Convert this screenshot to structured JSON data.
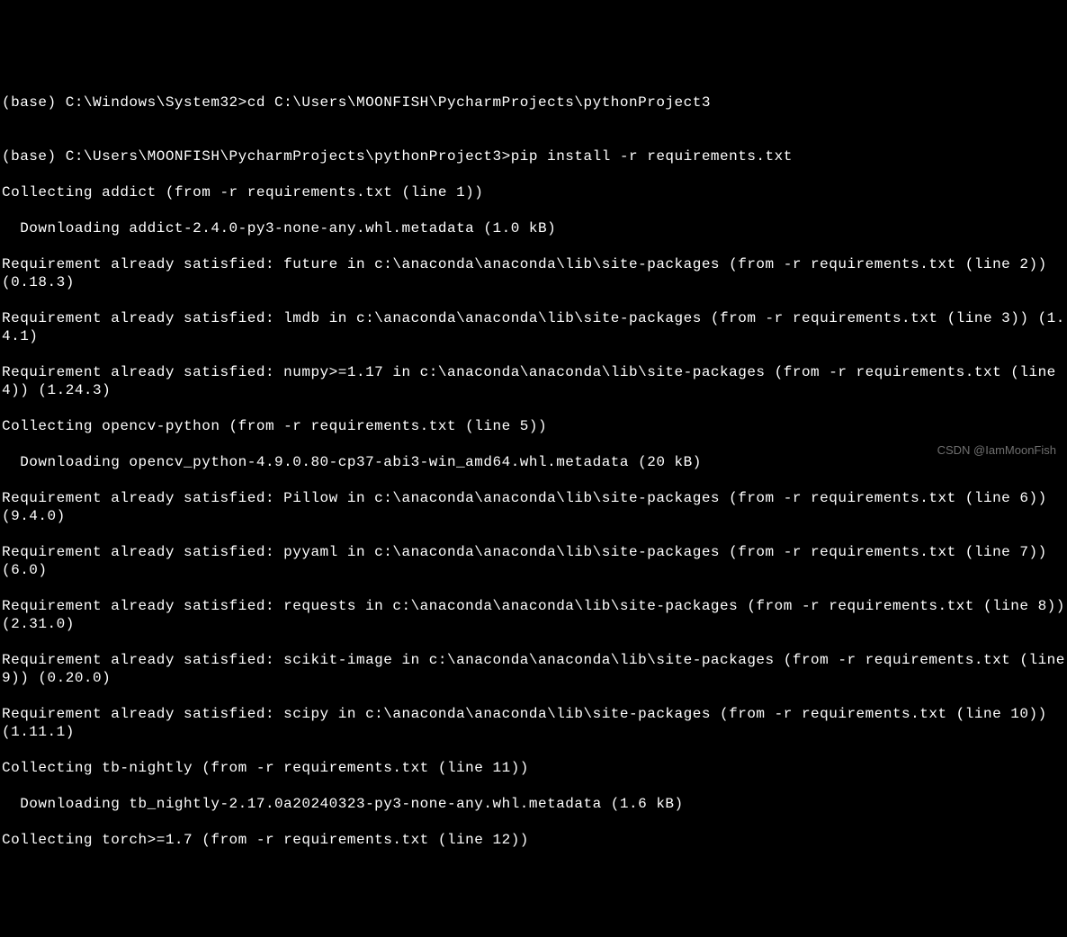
{
  "terminal": {
    "lines": [
      "(base) C:\\Windows\\System32>cd C:\\Users\\MOONFISH\\PycharmProjects\\pythonProject3",
      "",
      "(base) C:\\Users\\MOONFISH\\PycharmProjects\\pythonProject3>pip install -r requirements.txt",
      "Collecting addict (from -r requirements.txt (line 1))",
      "  Downloading addict-2.4.0-py3-none-any.whl.metadata (1.0 kB)",
      "Requirement already satisfied: future in c:\\anaconda\\anaconda\\lib\\site-packages (from -r requirements.txt (line 2)) (0.18.3)",
      "Requirement already satisfied: lmdb in c:\\anaconda\\anaconda\\lib\\site-packages (from -r requirements.txt (line 3)) (1.4.1)",
      "Requirement already satisfied: numpy>=1.17 in c:\\anaconda\\anaconda\\lib\\site-packages (from -r requirements.txt (line 4)) (1.24.3)",
      "Collecting opencv-python (from -r requirements.txt (line 5))",
      "  Downloading opencv_python-4.9.0.80-cp37-abi3-win_amd64.whl.metadata (20 kB)",
      "Requirement already satisfied: Pillow in c:\\anaconda\\anaconda\\lib\\site-packages (from -r requirements.txt (line 6)) (9.4.0)",
      "Requirement already satisfied: pyyaml in c:\\anaconda\\anaconda\\lib\\site-packages (from -r requirements.txt (line 7)) (6.0)",
      "Requirement already satisfied: requests in c:\\anaconda\\anaconda\\lib\\site-packages (from -r requirements.txt (line 8)) (2.31.0)",
      "Requirement already satisfied: scikit-image in c:\\anaconda\\anaconda\\lib\\site-packages (from -r requirements.txt (line 9)) (0.20.0)",
      "Requirement already satisfied: scipy in c:\\anaconda\\anaconda\\lib\\site-packages (from -r requirements.txt (line 10)) (1.11.1)",
      "Collecting tb-nightly (from -r requirements.txt (line 11))",
      "  Downloading tb_nightly-2.17.0a20240323-py3-none-any.whl.metadata (1.6 kB)",
      "Collecting torch>=1.7 (from -r requirements.txt (line 12))"
    ]
  },
  "watermark": "CSDN @IamMoonFish"
}
